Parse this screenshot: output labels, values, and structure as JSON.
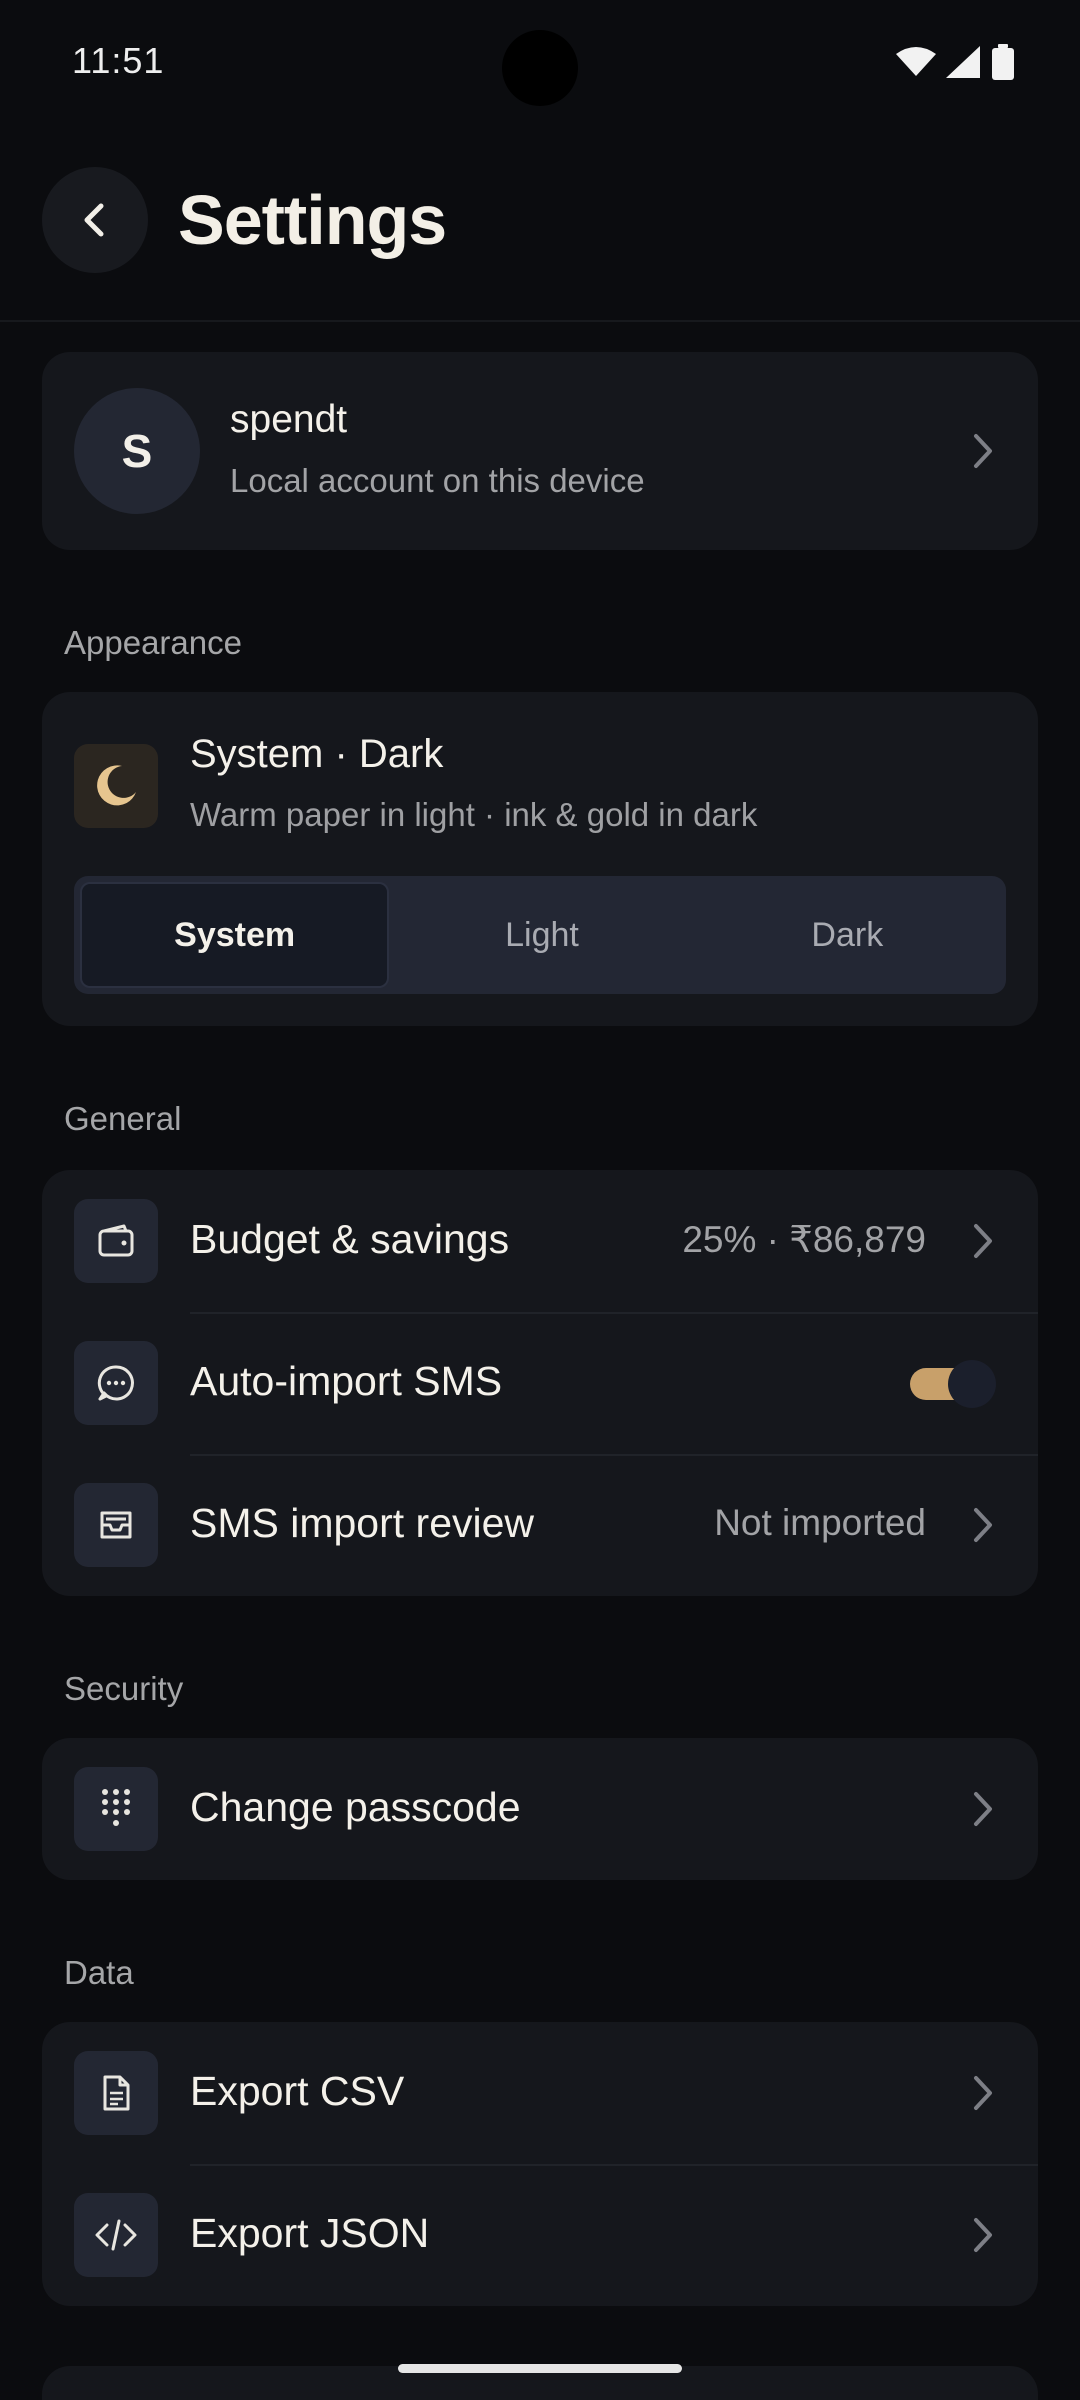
{
  "status_bar": {
    "time": "11:51"
  },
  "header": {
    "title": "Settings"
  },
  "profile": {
    "initial": "S",
    "name": "spendt",
    "subtitle": "Local account on this device"
  },
  "appearance": {
    "section_label": "Appearance",
    "title": "System · Dark",
    "subtitle": "Warm paper in light · ink & gold in dark",
    "options": [
      "System",
      "Light",
      "Dark"
    ],
    "selected": "System"
  },
  "general": {
    "section_label": "General",
    "rows": [
      {
        "label": "Budget & savings",
        "value": "25% · ₹86,879"
      },
      {
        "label": "Auto-import SMS",
        "toggle_on": true
      },
      {
        "label": "SMS import review",
        "value": "Not imported"
      }
    ]
  },
  "security": {
    "section_label": "Security",
    "rows": [
      {
        "label": "Change passcode"
      }
    ]
  },
  "data_section": {
    "section_label": "Data",
    "rows": [
      {
        "label": "Export CSV"
      },
      {
        "label": "Export JSON"
      }
    ]
  },
  "colors": {
    "background": "#0b0c0f",
    "card": "#15171c",
    "accent_gold": "#c8a06a",
    "text": "#f4f1ea",
    "muted": "#a2a3a6"
  }
}
